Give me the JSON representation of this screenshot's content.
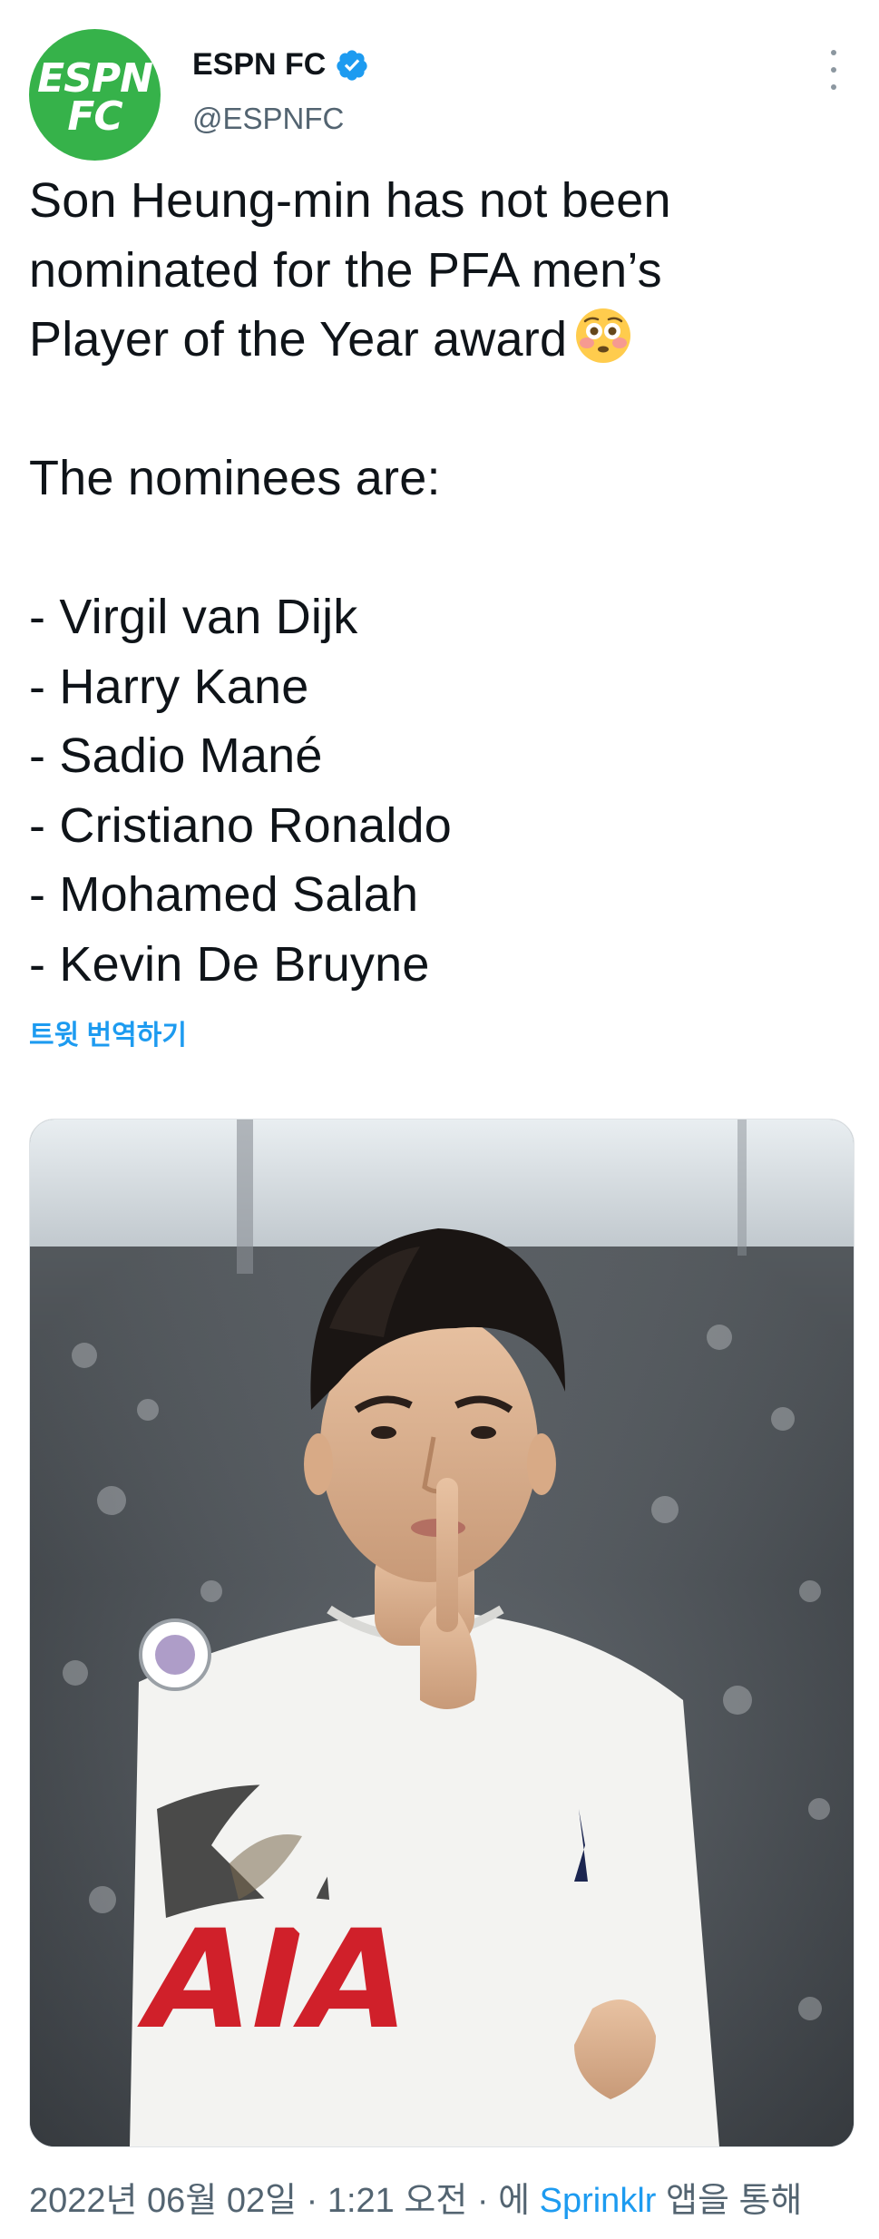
{
  "account": {
    "avatar_text_top": "ESPN",
    "avatar_text_bottom": "FC",
    "display_name": "ESPN FC",
    "handle": "@ESPNFC",
    "verified": true
  },
  "tweet": {
    "lines": [
      "Son Heung-min has not been",
      "nominated for the PFA men’s",
      "Player of the Year award",
      "",
      "The nominees are:",
      "",
      "- Virgil van Dijk",
      "- Harry Kane",
      "- Sadio Mané",
      "- Cristiano Ronaldo",
      "- Mohamed Salah",
      "- Kevin De Bruyne"
    ],
    "emoji": "flushed-face",
    "translate_label": "트윗 번역하기"
  },
  "media": {
    "alt_kind": "photo",
    "jersey_text": "AIA"
  },
  "footer": {
    "date": "2022년 06월 02일",
    "separator": "·",
    "time": "1:21 오전",
    "via_prefix": "에",
    "source": "Sprinklr",
    "via_suffix": "앱을 통해"
  },
  "colors": {
    "brand_green": "#36b24a",
    "link_blue": "#1d9bf0",
    "text": "#0f1419",
    "muted": "#536471"
  }
}
